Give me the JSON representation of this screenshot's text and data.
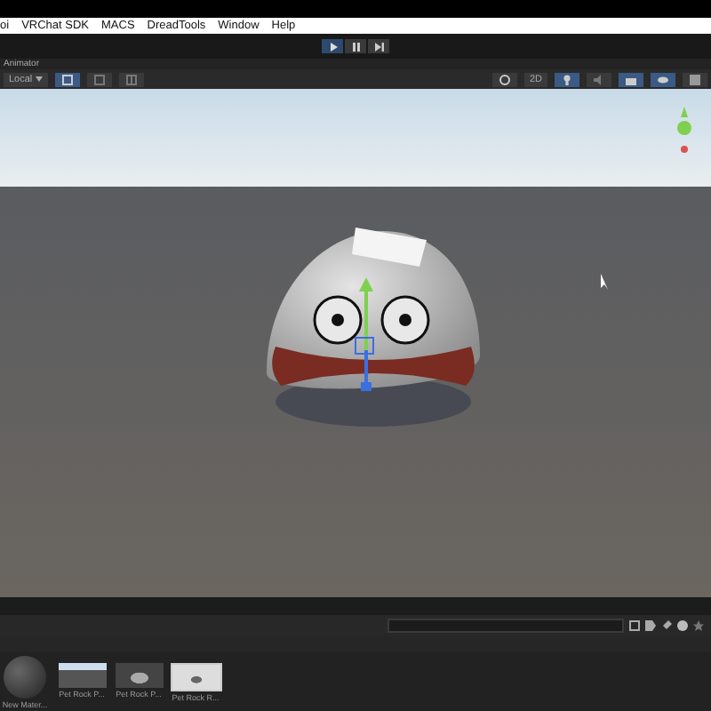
{
  "menu_bar": {
    "items": [
      "oi",
      "VRChat SDK",
      "MACS",
      "DreadTools",
      "Window",
      "Help"
    ]
  },
  "play_controls": {
    "playing": true
  },
  "scene_panel": {
    "tab": "Animator",
    "pivot": "Local",
    "view_mode": "2D",
    "mode_2d": false
  },
  "project_panel": {
    "assets": [
      {
        "label": "New Mater...",
        "kind": "material"
      },
      {
        "label": "Pet Rock P...",
        "kind": "scene"
      },
      {
        "label": "Pet Rock P...",
        "kind": "dark"
      },
      {
        "label": "Pet Rock R...",
        "kind": "light"
      }
    ]
  }
}
